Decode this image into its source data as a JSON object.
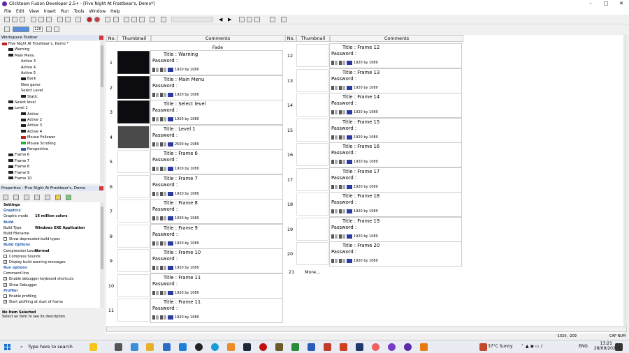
{
  "window": {
    "title": "Clickteam Fusion Developer 2.5+ - [Five Night At Frostbear's, Demo*]",
    "minimize": "–",
    "maximize": "□",
    "close": "✕"
  },
  "menu": [
    "File",
    "Edit",
    "View",
    "Insert",
    "Run",
    "Tools",
    "Window",
    "Help"
  ],
  "toolbar": {
    "zoom": "128"
  },
  "workspace": {
    "title": "Workspace Toolbar",
    "root": "Five Night At Frostbear's, Demo *",
    "items": [
      {
        "label": "Warning",
        "icon": "frame",
        "indent": 1
      },
      {
        "label": "Main Menu",
        "icon": "frame",
        "indent": 1
      },
      {
        "label": "Active 3",
        "icon": "none",
        "indent": 2
      },
      {
        "label": "Active 4",
        "icon": "none",
        "indent": 2
      },
      {
        "label": "Active 5",
        "icon": "none",
        "indent": 2
      },
      {
        "label": "Back",
        "icon": "black",
        "indent": 2
      },
      {
        "label": "New game",
        "icon": "none",
        "indent": 2
      },
      {
        "label": "Select Level",
        "icon": "none",
        "indent": 2
      },
      {
        "label": "Static",
        "icon": "black",
        "indent": 2
      },
      {
        "label": "Select level",
        "icon": "frame",
        "indent": 1
      },
      {
        "label": "Level 1",
        "icon": "frame",
        "indent": 1
      },
      {
        "label": "Active",
        "icon": "black",
        "indent": 2
      },
      {
        "label": "Active 2",
        "icon": "black",
        "indent": 2
      },
      {
        "label": "Active 3",
        "icon": "black",
        "indent": 2
      },
      {
        "label": "Active 4",
        "icon": "black",
        "indent": 2
      },
      {
        "label": "Mouse Follower",
        "icon": "red",
        "indent": 2
      },
      {
        "label": "Mouse Scrolling",
        "icon": "green",
        "indent": 2
      },
      {
        "label": "Perspective",
        "icon": "blue",
        "indent": 2
      },
      {
        "label": "Frame 6",
        "icon": "frame",
        "indent": 1
      },
      {
        "label": "Frame 7",
        "icon": "frame",
        "indent": 1
      },
      {
        "label": "Frame 8",
        "icon": "frame",
        "indent": 1
      },
      {
        "label": "Frame 9",
        "icon": "frame",
        "indent": 1
      },
      {
        "label": "Frame 10",
        "icon": "frame",
        "indent": 1
      }
    ]
  },
  "properties": {
    "title": "Properties - Five Night At Frostbear's, Demo",
    "rows": [
      {
        "type": "top",
        "label": "Settings"
      },
      {
        "type": "sec",
        "label": "Graphics"
      },
      {
        "type": "kv",
        "label": "Graphic mode",
        "value": "16 million colors"
      },
      {
        "type": "sec",
        "label": "Build"
      },
      {
        "type": "kv",
        "label": "Build Type",
        "value": "Windows EXE Application"
      },
      {
        "type": "kv",
        "label": "Build Filename",
        "value": ""
      },
      {
        "type": "cb",
        "label": "Show deprecated build types",
        "checked": false
      },
      {
        "type": "sec",
        "label": "Build Options"
      },
      {
        "type": "kv",
        "label": "Compression Level",
        "value": "Normal"
      },
      {
        "type": "cb",
        "label": "Compress Sounds",
        "checked": false
      },
      {
        "type": "cb",
        "label": "Display build warning messages",
        "checked": true
      },
      {
        "type": "sec",
        "label": "Run options"
      },
      {
        "type": "kv",
        "label": "Command line",
        "value": ""
      },
      {
        "type": "cb",
        "label": "Enable debugger keyboard shortcuts",
        "checked": true
      },
      {
        "type": "cb",
        "label": "Show Debugger",
        "checked": true
      },
      {
        "type": "sec",
        "label": "Profiler"
      },
      {
        "type": "cb",
        "label": "Enable profiling",
        "checked": false
      },
      {
        "type": "cb",
        "label": "Start profiling at start of frame",
        "checked": true
      }
    ],
    "desc_title": "No Item Selected",
    "desc_text": "Select an item to see its description"
  },
  "storyboard": {
    "headers": {
      "no": "No.",
      "thumbnail": "Thumbnail",
      "comments": "Comments"
    },
    "fade": "Fade",
    "title_prefix": "Title :",
    "password": "Password :",
    "more": "More...",
    "left": [
      {
        "no": "1",
        "title": "Warning",
        "res": "1920 by 1080",
        "thumb": "dark"
      },
      {
        "no": "2",
        "title": "Main Menu",
        "res": "1920 by 1080",
        "thumb": "dark"
      },
      {
        "no": "3",
        "title": "Select level",
        "res": "1920 by 1080",
        "thumb": "dark"
      },
      {
        "no": "4",
        "title": "Level 1",
        "res": "2500 by 1080",
        "thumb": "photo"
      },
      {
        "no": "5",
        "title": "Frame 6",
        "res": "1920 by 1080",
        "thumb": "blank"
      },
      {
        "no": "6",
        "title": "Frame 7",
        "res": "1920 by 1080",
        "thumb": "blank"
      },
      {
        "no": "7",
        "title": "Frame 8",
        "res": "1920 by 1080",
        "thumb": "blank"
      },
      {
        "no": "8",
        "title": "Frame 9",
        "res": "1920 by 1080",
        "thumb": "blank"
      },
      {
        "no": "9",
        "title": "Frame 10",
        "res": "1920 by 1080",
        "thumb": "blank"
      },
      {
        "no": "10",
        "title": "Frame 11",
        "res": "1920 by 1080",
        "thumb": "blank"
      },
      {
        "no": "11",
        "title": "Frame 11",
        "res": "1920 by 1080",
        "thumb": "blank"
      }
    ],
    "right": [
      {
        "no": "12",
        "title": "Frame 12",
        "res": "1920 by 1080"
      },
      {
        "no": "13",
        "title": "Frame 13",
        "res": "1920 by 1080"
      },
      {
        "no": "14",
        "title": "Frame 14",
        "res": "1920 by 1080"
      },
      {
        "no": "15",
        "title": "Frame 15",
        "res": "1920 by 1080"
      },
      {
        "no": "16",
        "title": "Frame 16",
        "res": "1920 by 1080"
      },
      {
        "no": "17",
        "title": "Frame 17",
        "res": "1920 by 1080"
      },
      {
        "no": "18",
        "title": "Frame 18",
        "res": "1920 by 1080"
      },
      {
        "no": "19",
        "title": "Frame 19",
        "res": "1920 by 1080"
      },
      {
        "no": "20",
        "title": "Frame 20",
        "res": "1920 by 1080"
      }
    ],
    "more_no": "21"
  },
  "status": {
    "coords": "-1020, -209",
    "caps": "CAP NUM"
  },
  "taskbar": {
    "search": "Type here to search",
    "weather": "37°C Sunny",
    "lang": "ENG",
    "time": "13:21",
    "date": "28/09/2025"
  }
}
